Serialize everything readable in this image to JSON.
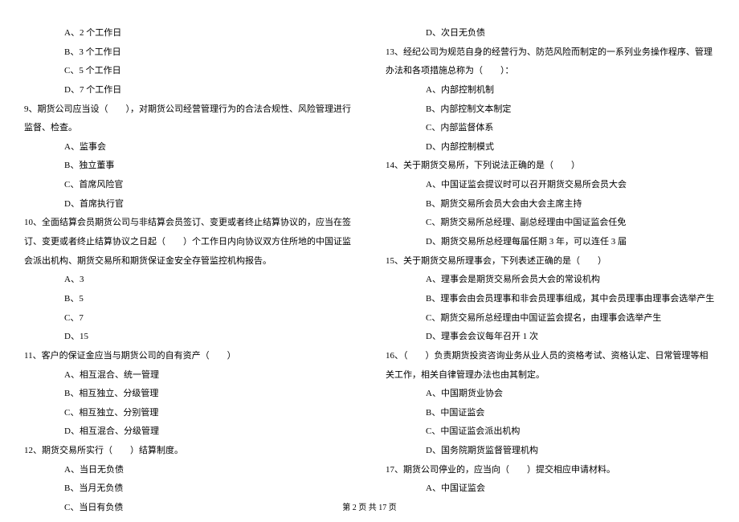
{
  "left": {
    "q8_opts": [
      "A、2 个工作日",
      "B、3 个工作日",
      "C、5 个工作日",
      "D、7 个工作日"
    ],
    "q9": "9、期货公司应当设（　　），对期货公司经营管理行为的合法合规性、风险管理进行监督、检查。",
    "q9_opts": [
      "A、监事会",
      "B、独立董事",
      "C、首席风险官",
      "D、首席执行官"
    ],
    "q10": "10、全面结算会员期货公司与非结算会员签订、变更或者终止结算协议的，应当在签订、变更或者终止结算协议之日起（　　）个工作日内向协议双方住所地的中国证监会派出机构、期货交易所和期货保证金安全存管监控机构报告。",
    "q10_opts": [
      "A、3",
      "B、5",
      "C、7",
      "D、15"
    ],
    "q11": "11、客户的保证金应当与期货公司的自有资产（　　）",
    "q11_opts": [
      "A、相互混合、统一管理",
      "B、相互独立、分级管理",
      "C、相互独立、分别管理",
      "D、相互混合、分级管理"
    ],
    "q12": "12、期货交易所实行（　　）结算制度。",
    "q12_opts": [
      "A、当日无负债",
      "B、当月无负债",
      "C、当日有负债"
    ]
  },
  "right": {
    "q12_opts_cont": [
      "D、次日无负债"
    ],
    "q13": "13、经纪公司为规范自身的经营行为、防范风险而制定的一系列业务操作程序、管理办法和各项措施总称为（　　）：",
    "q13_opts": [
      "A、内部控制机制",
      "B、内部控制文本制定",
      "C、内部监督体系",
      "D、内部控制模式"
    ],
    "q14": "14、关于期货交易所，下列说法正确的是（　　）",
    "q14_opts": [
      "A、中国证监会提议时可以召开期货交易所会员大会",
      "B、期货交易所会员大会由大会主席主持",
      "C、期货交易所总经理、副总经理由中国证监会任免",
      "D、期货交易所总经理每届任期 3 年，可以连任 3 届"
    ],
    "q15": "15、关于期货交易所理事会，下列表述正确的是（　　）",
    "q15_opts": [
      "A、理事会是期货交易所会员大会的常设机构",
      "B、理事会由会员理事和非会员理事组成，其中会员理事由理事会选举产生",
      "C、期货交易所总经理由中国证监会提名，由理事会选举产生",
      "D、理事会会议每年召开 1 次"
    ],
    "q16": "16、（　　）负责期货投资咨询业务从业人员的资格考试、资格认定、日常管理等相关工作，相关自律管理办法也由其制定。",
    "q16_opts": [
      "A、中国期货业协会",
      "B、中国证监会",
      "C、中国证监会派出机构",
      "D、国务院期货监督管理机构"
    ],
    "q17": "17、期货公司停业的，应当向（　　）提交相应申请材料。",
    "q17_opts": [
      "A、中国证监会"
    ]
  },
  "footer": "第 2 页 共 17 页"
}
